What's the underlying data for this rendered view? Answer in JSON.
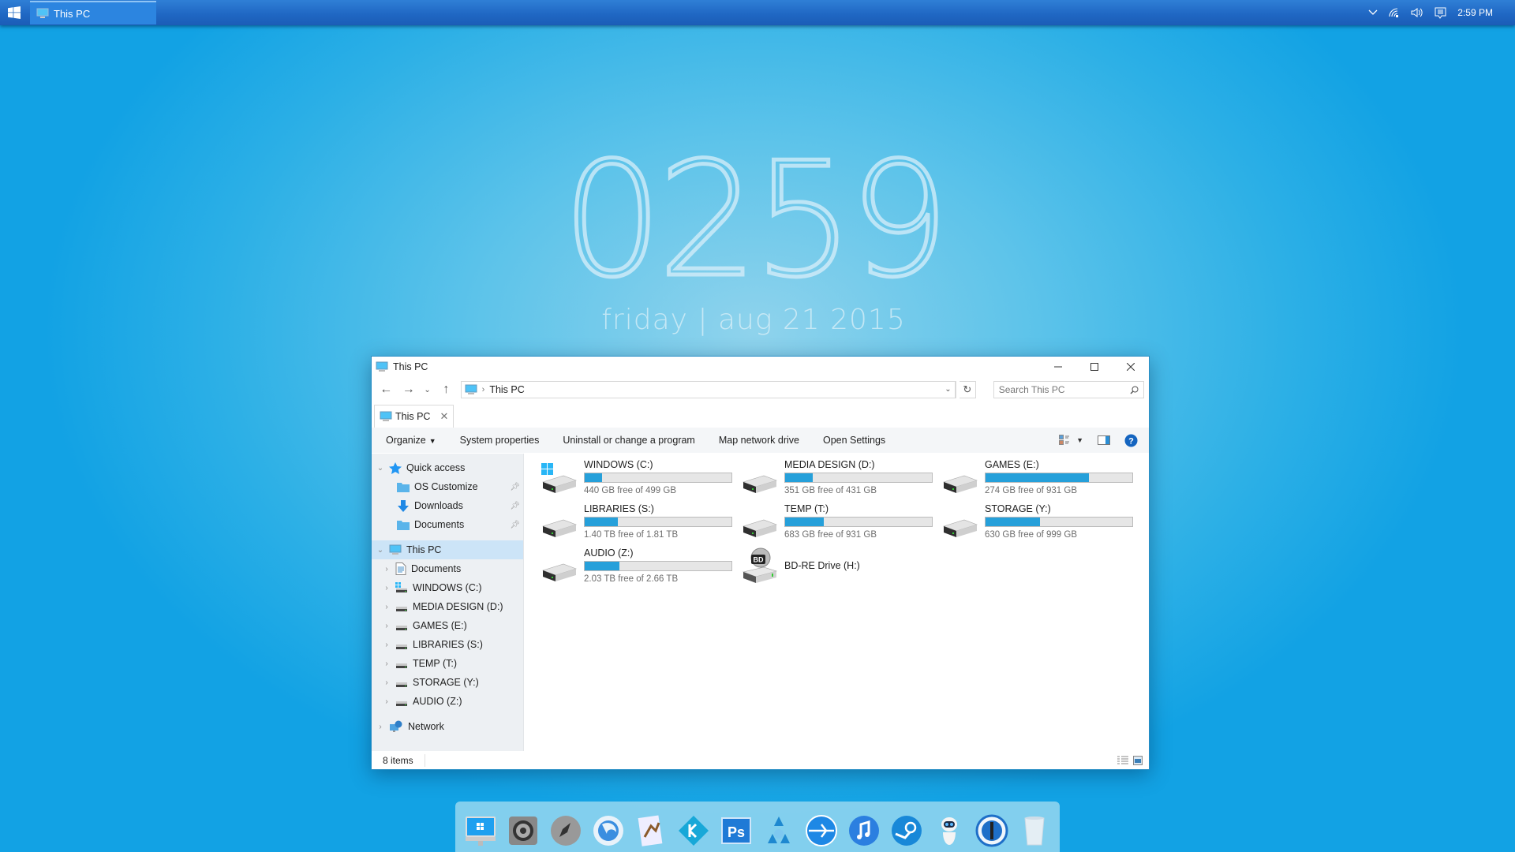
{
  "taskbar": {
    "start_icon": "windows-logo-icon",
    "task_item": {
      "icon": "computer-icon",
      "label": "This PC"
    },
    "tray": {
      "icons": [
        "chevron-up-icon",
        "wifi-icon",
        "volume-icon",
        "action-center-icon"
      ],
      "time": "2:59 PM"
    }
  },
  "desktop_clock": {
    "time": "0259",
    "date": "friday | aug 21 2015"
  },
  "window": {
    "title": "This PC",
    "controls": {
      "minimize": "minimize",
      "maximize": "maximize",
      "close": "close"
    },
    "address": {
      "path": "This PC",
      "separator": "›"
    },
    "search": {
      "placeholder": "Search This PC"
    },
    "tab": {
      "label": "This PC"
    },
    "commands": [
      {
        "label": "Organize",
        "dropdown": true
      },
      {
        "label": "System properties"
      },
      {
        "label": "Uninstall or change a program"
      },
      {
        "label": "Map network drive"
      },
      {
        "label": "Open Settings"
      }
    ],
    "sidebar": {
      "quick_access": {
        "label": "Quick access",
        "items": [
          {
            "label": "OS Customize",
            "icon": "folder-icon",
            "pinned": true
          },
          {
            "label": "Downloads",
            "icon": "download-arrow-icon",
            "pinned": true
          },
          {
            "label": "Documents",
            "icon": "folder-icon",
            "pinned": true
          }
        ]
      },
      "this_pc": {
        "label": "This PC",
        "selected": true,
        "items": [
          {
            "label": "Documents",
            "icon": "document-icon"
          },
          {
            "label": "WINDOWS (C:)",
            "icon": "system-drive-icon"
          },
          {
            "label": "MEDIA DESIGN (D:)",
            "icon": "drive-icon"
          },
          {
            "label": "GAMES (E:)",
            "icon": "drive-icon"
          },
          {
            "label": "LIBRARIES (S:)",
            "icon": "drive-icon"
          },
          {
            "label": "TEMP (T:)",
            "icon": "drive-icon"
          },
          {
            "label": "STORAGE (Y:)",
            "icon": "drive-icon"
          },
          {
            "label": "AUDIO (Z:)",
            "icon": "drive-icon"
          }
        ]
      },
      "network": {
        "label": "Network"
      }
    },
    "drives": [
      {
        "name": "WINDOWS (C:)",
        "free": "440 GB free of 499 GB",
        "used_fraction": 0.118,
        "system": true
      },
      {
        "name": "MEDIA DESIGN (D:)",
        "free": "351 GB free of 431 GB",
        "used_fraction": 0.186
      },
      {
        "name": "GAMES (E:)",
        "free": "274 GB free of 931 GB",
        "used_fraction": 0.706
      },
      {
        "name": "LIBRARIES (S:)",
        "free": "1.40 TB free of 1.81 TB",
        "used_fraction": 0.227
      },
      {
        "name": "TEMP (T:)",
        "free": "683 GB free of 931 GB",
        "used_fraction": 0.266
      },
      {
        "name": "STORAGE (Y:)",
        "free": "630 GB free of 999 GB",
        "used_fraction": 0.369
      },
      {
        "name": "AUDIO (Z:)",
        "free": "2.03 TB free of 2.66 TB",
        "used_fraction": 0.237
      },
      {
        "name": "BD-RE Drive (H:)",
        "optical": true
      }
    ],
    "status": {
      "items_count": "8 items"
    }
  },
  "dock": {
    "apps": [
      "this-pc",
      "system-settings",
      "launchpad",
      "firefox",
      "mail",
      "kodi",
      "photoshop",
      "mixer",
      "browser",
      "itunes",
      "steam",
      "eve-robot",
      "1password",
      "recycle-bin"
    ]
  },
  "colors": {
    "accent": "#26a0da",
    "taskbar": "#1f66c2",
    "selection": "#cce4f7",
    "sidebar_bg": "#edf0f3"
  }
}
